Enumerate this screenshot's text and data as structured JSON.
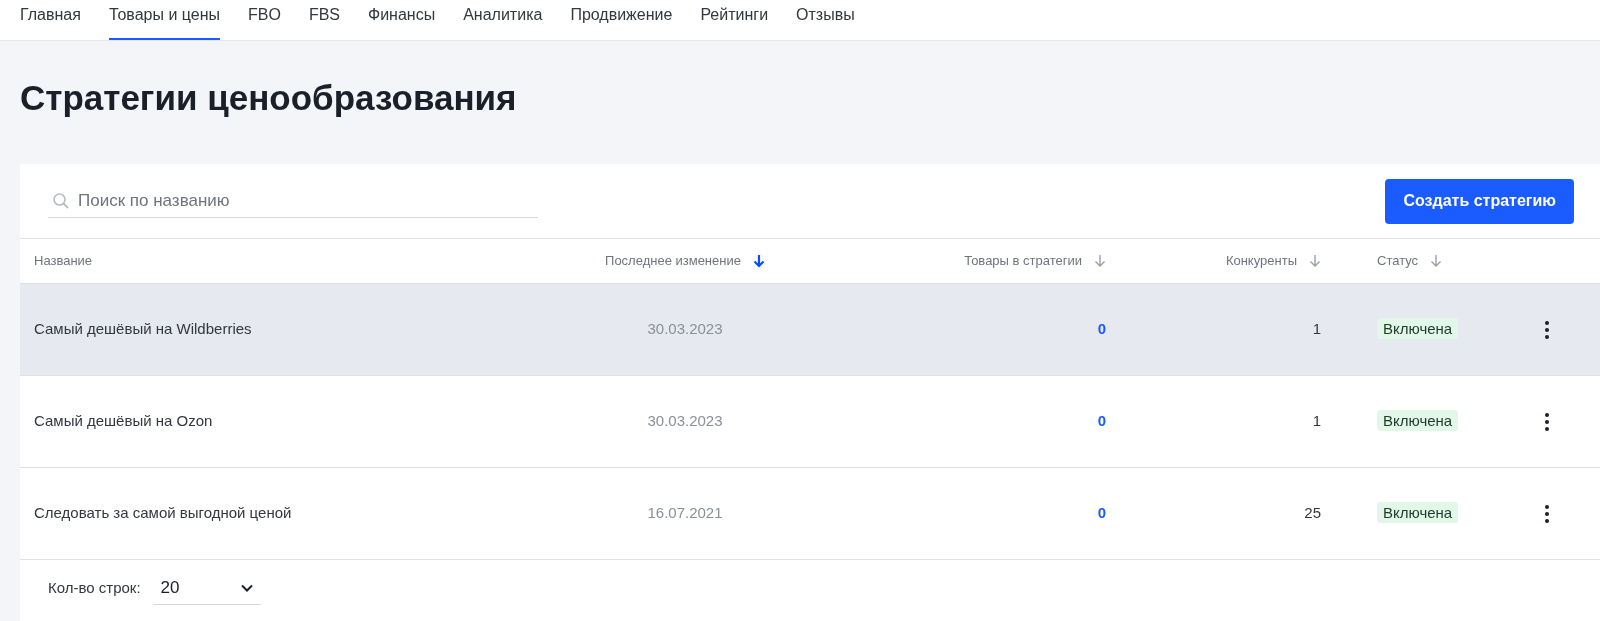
{
  "nav": {
    "tabs": [
      {
        "label": "Главная",
        "selected": false
      },
      {
        "label": "Товары и цены",
        "selected": true
      },
      {
        "label": "FBO",
        "selected": false
      },
      {
        "label": "FBS",
        "selected": false
      },
      {
        "label": "Финансы",
        "selected": false
      },
      {
        "label": "Аналитика",
        "selected": false
      },
      {
        "label": "Продвижение",
        "selected": false
      },
      {
        "label": "Рейтинги",
        "selected": false
      },
      {
        "label": "Отзывы",
        "selected": false
      }
    ]
  },
  "page_title": "Стратегии ценообразования",
  "search": {
    "placeholder": "Поиск по названию"
  },
  "create_button": "Создать стратегию",
  "table": {
    "columns": [
      {
        "label": "Название",
        "sortable": false,
        "selected": false
      },
      {
        "label": "Последнее изменение",
        "sortable": true,
        "selected": true
      },
      {
        "label": "Товары в стратегии",
        "sortable": true,
        "selected": false
      },
      {
        "label": "Конкуренты",
        "sortable": true,
        "selected": false
      },
      {
        "label": "Статус",
        "sortable": true,
        "selected": false
      }
    ],
    "rows": [
      {
        "name": "Самый дешёвый на Wildberries",
        "date": "30.03.2023",
        "products": "0",
        "competitors": "1",
        "status": "Включена",
        "highlighted": true
      },
      {
        "name": "Самый дешёвый на Ozon",
        "date": "30.03.2023",
        "products": "0",
        "competitors": "1",
        "status": "Включена",
        "highlighted": false
      },
      {
        "name": "Следовать за самой выгодной ценой",
        "date": "16.07.2021",
        "products": "0",
        "competitors": "25",
        "status": "Включена",
        "highlighted": false
      }
    ]
  },
  "footer": {
    "rows_label": "Кол-во строк:",
    "rows_value": "20"
  }
}
